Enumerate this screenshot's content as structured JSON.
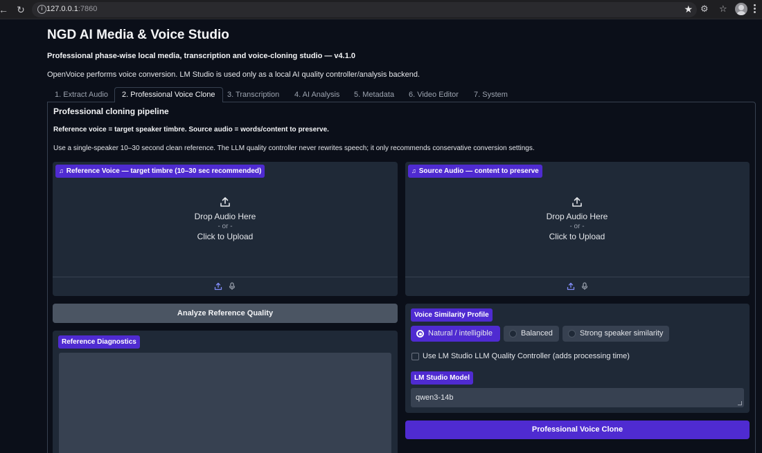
{
  "browser": {
    "url_host": "127.0.0.1",
    "url_port": ":7860"
  },
  "app": {
    "title": "NGD AI Media & Voice Studio",
    "subtitle": "Professional phase-wise local media, transcription and voice-cloning studio — v4.1.0",
    "description": "OpenVoice performs voice conversion. LM Studio is used only as a local AI quality controller/analysis backend."
  },
  "tabs": [
    {
      "label": "1. Extract Audio",
      "active": false
    },
    {
      "label": "2. Professional Voice Clone",
      "active": true
    },
    {
      "label": "3. Transcription",
      "active": false
    },
    {
      "label": "4. AI Analysis",
      "active": false
    },
    {
      "label": "5. Metadata",
      "active": false
    },
    {
      "label": "6. Video Editor",
      "active": false
    },
    {
      "label": "7. System",
      "active": false
    }
  ],
  "section": {
    "title": "Professional cloning pipeline",
    "line1": "Reference voice = target speaker timbre. Source audio = words/content to preserve.",
    "line2": "Use a single-speaker 10–30 second clean reference. The LLM quality controller never rewrites speech; it only recommends conservative conversion settings."
  },
  "reference_upload": {
    "label": "Reference Voice — target timbre (10–30 sec recommended)",
    "drop_text": "Drop Audio Here",
    "or_text": "- or -",
    "click_text": "Click to Upload"
  },
  "source_upload": {
    "label": "Source Audio — content to preserve",
    "drop_text": "Drop Audio Here",
    "or_text": "- or -",
    "click_text": "Click to Upload"
  },
  "analyze_button": "Analyze Reference Quality",
  "diagnostics": {
    "label": "Reference Diagnostics",
    "value": ""
  },
  "similarity": {
    "label": "Voice Similarity Profile",
    "options": [
      {
        "label": "Natural / intelligible",
        "selected": true
      },
      {
        "label": "Balanced",
        "selected": false
      },
      {
        "label": "Strong speaker similarity",
        "selected": false
      }
    ]
  },
  "llm_checkbox": {
    "label": "Use LM Studio LLM Quality Controller (adds processing time)",
    "checked": false
  },
  "model": {
    "label": "LM Studio Model",
    "value": "qwen3-14b"
  },
  "clone_button": "Professional Voice Clone",
  "colors": {
    "accent": "#4f2bd1",
    "background": "#0b0f19",
    "block": "#1f2937",
    "input": "#374151"
  }
}
